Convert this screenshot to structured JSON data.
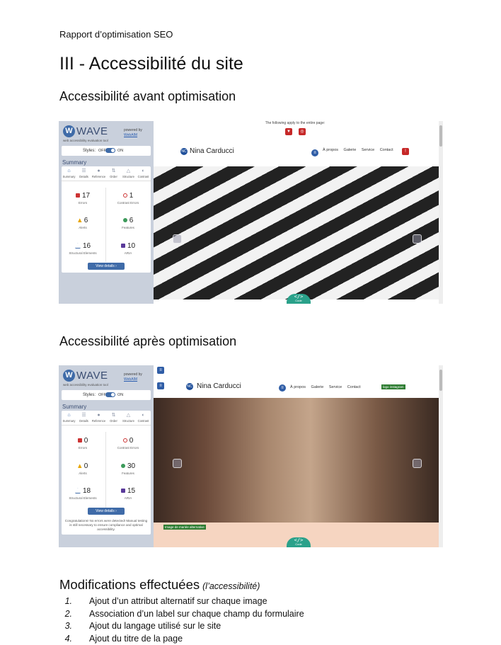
{
  "header": {
    "text": "Rapport d’optimisation SEO"
  },
  "section": {
    "title": "III - Accessibilité du site",
    "before_title": "Accessibilité avant optimisation",
    "after_title": "Accessibilité après optimisation",
    "modifications_title": "Modifications effectuées",
    "modifications_subtitle": "(l’accessibilité)"
  },
  "wave": {
    "logo_letter": "W",
    "name": "WAVE",
    "tagline": "web accessibility evaluation tool",
    "powered_by": "powered by",
    "powered_link": "WebAIM",
    "styles_label": "Styles:",
    "styles_off": "OFF",
    "styles_on": "ON",
    "summary_title": "Summary",
    "tabs": [
      "Summary",
      "Details",
      "Reference",
      "Order",
      "Structure",
      "Contrast"
    ],
    "labels": {
      "errors": "Errors",
      "contrast_errors": "Contrast Errors",
      "alerts": "Alerts",
      "features": "Features",
      "structural": "Structural Elements",
      "aria": "ARIA"
    },
    "view_details": "View details ›",
    "congrats": "Congratulations! No errors were detected! Manual testing is still necessary to ensure compliance and optimal accessibility."
  },
  "before": {
    "errors": "17",
    "contrast_errors": "1",
    "alerts": "6",
    "features": "6",
    "structural": "16",
    "aria": "10",
    "applies_text": "The following apply to the entire page:"
  },
  "after": {
    "errors": "0",
    "contrast_errors": "0",
    "alerts": "0",
    "features": "30",
    "structural": "18",
    "aria": "15",
    "green_tag": "logo instagram",
    "bottom_tag": "Image de mariée alternative"
  },
  "site": {
    "name": "Nina Carducci",
    "nav": [
      "À propos",
      "Galerie",
      "Service",
      "Contact"
    ],
    "code_label": "Code"
  },
  "modifications": [
    {
      "num": "1.",
      "text": "Ajout d’un attribut alternatif sur chaque image"
    },
    {
      "num": "2.",
      "text": "Association d’un label sur chaque champ du formulaire"
    },
    {
      "num": "3.",
      "text": "Ajout du langage utilisé sur le site"
    },
    {
      "num": "4.",
      "text": "Ajout du titre de la page"
    }
  ]
}
